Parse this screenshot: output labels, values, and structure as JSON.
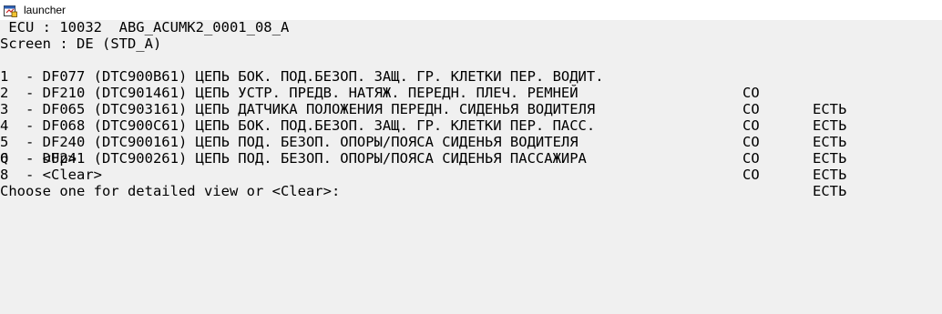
{
  "window": {
    "title": "launcher",
    "icon": "launcher-app-icon"
  },
  "console": {
    "ecu_line": " ECU : 10032  ABG_ACUMK2_0001_08_A",
    "screen_line": "Screen : DE (STD_A)",
    "faults": [
      {
        "text": "1  - DF077 (DTC900B61) ЦЕПЬ БОК. ПОД.БЕЗОП. ЗАЩ. ГР. КЛЕТКИ ПЕР. ВОДИТ.",
        "status": "CO",
        "state": "ЕСТЬ"
      },
      {
        "text": "2  - DF210 (DTC901461) ЦЕПЬ УСТР. ПРЕДВ. НАТЯЖ. ПЕРЕДН. ПЛЕЧ. РЕМНЕЙ",
        "status": "CO",
        "state": "ЕСТЬ"
      },
      {
        "text": "3  - DF065 (DTC903161) ЦЕПЬ ДАТЧИКА ПОЛОЖЕНИЯ ПЕРЕДН. СИДЕНЬЯ ВОДИТЕЛЯ",
        "status": "CO",
        "state": "ЕСТЬ"
      },
      {
        "text": "4  - DF068 (DTC900C61) ЦЕПЬ БОК. ПОД.БЕЗОП. ЗАЩ. ГР. КЛЕТКИ ПЕР. ПАСС.",
        "status": "CO",
        "state": "ЕСТЬ"
      },
      {
        "text": "5  - DF240 (DTC900161) ЦЕПЬ ПОД. БЕЗОП. ОПОРЫ/ПОЯСА СИДЕНЬЯ ВОДИТЕЛЯ",
        "status": "CO",
        "state": "ЕСТЬ"
      },
      {
        "text": "6  - DF241 (DTC900261) ЦЕПЬ ПОД. БЕЗОП. ОПОРЫ/ПОЯСА СИДЕНЬЯ ПАССАЖИРА",
        "status": "CO",
        "state": "ЕСТЬ"
      }
    ],
    "up_option": "Q  - <Up>",
    "clear_option": "8  - <Clear>",
    "prompt": "Choose one for detailed view or <Clear>:"
  }
}
